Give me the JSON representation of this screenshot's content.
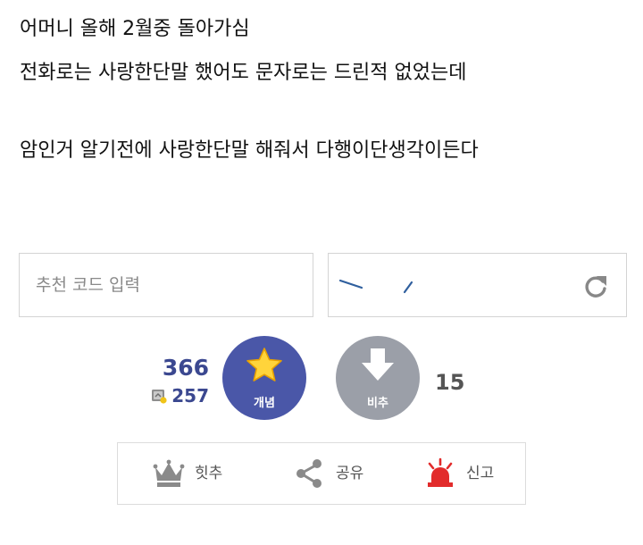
{
  "post": {
    "lines": [
      "어머니 올해 2월중 돌아가심",
      "전화로는 사랑한단말 했어도 문자로는 드린적 없었는데",
      "암인거 알기전에 사랑한단말 해줘서 다행이단생각이든다"
    ]
  },
  "recommend_code": {
    "placeholder": "추천 코드 입력",
    "value": ""
  },
  "captcha": {
    "refresh_icon": "refresh-icon"
  },
  "votes": {
    "up_count": "366",
    "fix_count": "257",
    "up_label": "개념",
    "down_label": "비추",
    "down_count": "15",
    "up_color": "#4a57a8",
    "down_color": "#9b9fa8",
    "count_color": "#3b4890"
  },
  "actions": {
    "hit_label": "힛추",
    "share_label": "공유",
    "report_label": "신고",
    "hit_icon": "crown-icon",
    "share_icon": "share-icon",
    "report_icon": "siren-icon"
  }
}
